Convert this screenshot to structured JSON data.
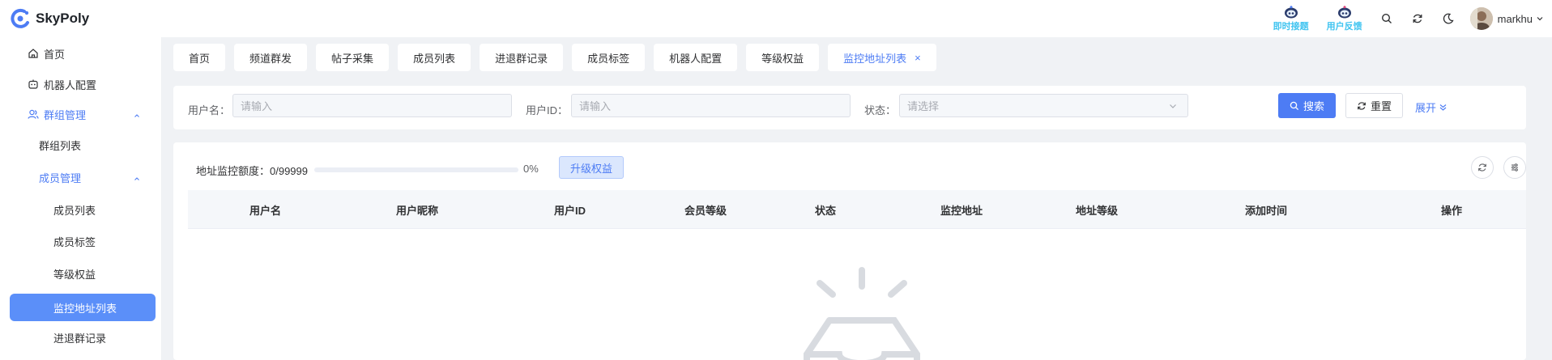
{
  "app": {
    "name": "SkyPoly"
  },
  "header": {
    "promos": [
      {
        "label": "即时接题",
        "icon": "robot-icon"
      },
      {
        "label": "用户反馈",
        "icon": "robot-icon"
      }
    ],
    "icons": [
      "search-icon",
      "refresh-icon",
      "moon-icon"
    ],
    "user": {
      "name": "markhu"
    }
  },
  "sidebar": {
    "items": [
      {
        "label": "首页",
        "icon": "home-icon"
      },
      {
        "label": "机器人配置",
        "icon": "robot-icon"
      },
      {
        "label": "群组管理",
        "icon": "users-icon"
      },
      {
        "label": "群组列表"
      },
      {
        "label": "成员管理"
      },
      {
        "label": "成员列表"
      },
      {
        "label": "成员标签"
      },
      {
        "label": "等级权益"
      },
      {
        "label": "监控地址列表"
      },
      {
        "label": "进退群记录"
      }
    ]
  },
  "tabs": [
    {
      "label": "首页"
    },
    {
      "label": "频道群发"
    },
    {
      "label": "帖子采集"
    },
    {
      "label": "成员列表"
    },
    {
      "label": "进退群记录"
    },
    {
      "label": "成员标签"
    },
    {
      "label": "机器人配置"
    },
    {
      "label": "等级权益"
    },
    {
      "label": "监控地址列表",
      "active": true,
      "close": "×"
    }
  ],
  "search": {
    "username_label": "用户名：",
    "username_placeholder": "请输入",
    "userid_label": "用户ID：",
    "userid_placeholder": "请输入",
    "status_label": "状态：",
    "status_placeholder": "请选择",
    "search_button": "搜索",
    "reset_button": "重置",
    "expand": "展开"
  },
  "quota": {
    "label": "地址监控额度：0/99999",
    "progress_percent": 0,
    "percent_text": "0%",
    "upgrade_button": "升级权益"
  },
  "table": {
    "columns": [
      "用户名",
      "用户昵称",
      "用户ID",
      "会员等级",
      "状态",
      "监控地址",
      "地址等级",
      "添加时间",
      "操作"
    ]
  },
  "colors": {
    "primary": "#4d7cf4",
    "active_menu_bg": "#5b8ff9",
    "promo": "#40c4f0"
  }
}
